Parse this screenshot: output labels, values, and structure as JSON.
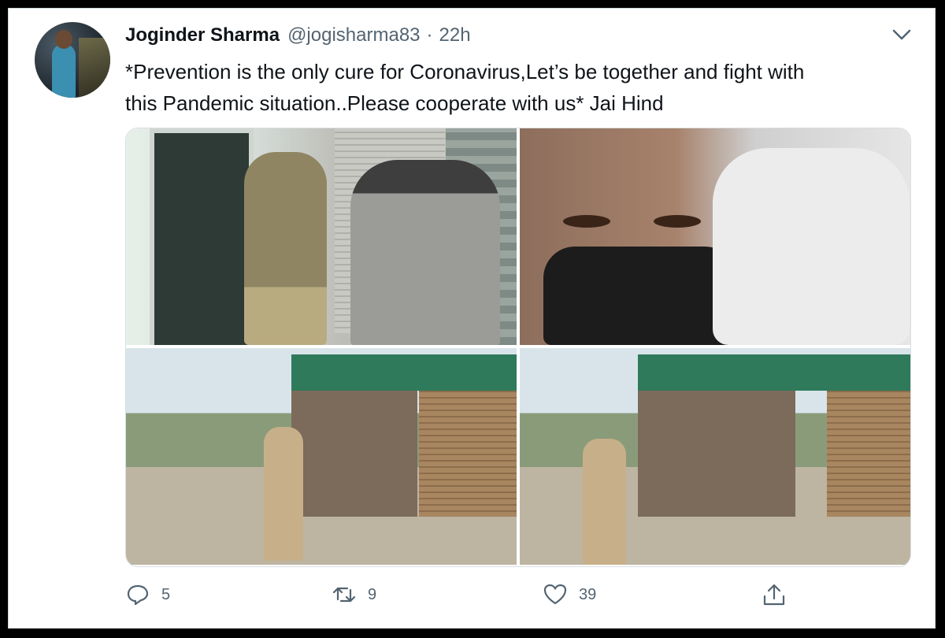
{
  "tweet": {
    "author_name": "Joginder Sharma",
    "author_handle": "@jogisharma83",
    "separator": "·",
    "time": "22h",
    "text": "*Prevention is the only cure for Coronavirus,Let’s be together and fight with\nthis Pandemic situation..Please cooperate with us* Jai Hind"
  },
  "media": {
    "photo_count": 4
  },
  "actions": {
    "reply_count": "5",
    "retweet_count": "9",
    "like_count": "39"
  },
  "icons": {
    "reply": "reply-icon",
    "retweet": "retweet-icon",
    "like": "heart-icon",
    "share": "share-icon",
    "more": "chevron-down-icon"
  },
  "colors": {
    "text_primary": "#0f1419",
    "text_secondary": "#536471"
  }
}
